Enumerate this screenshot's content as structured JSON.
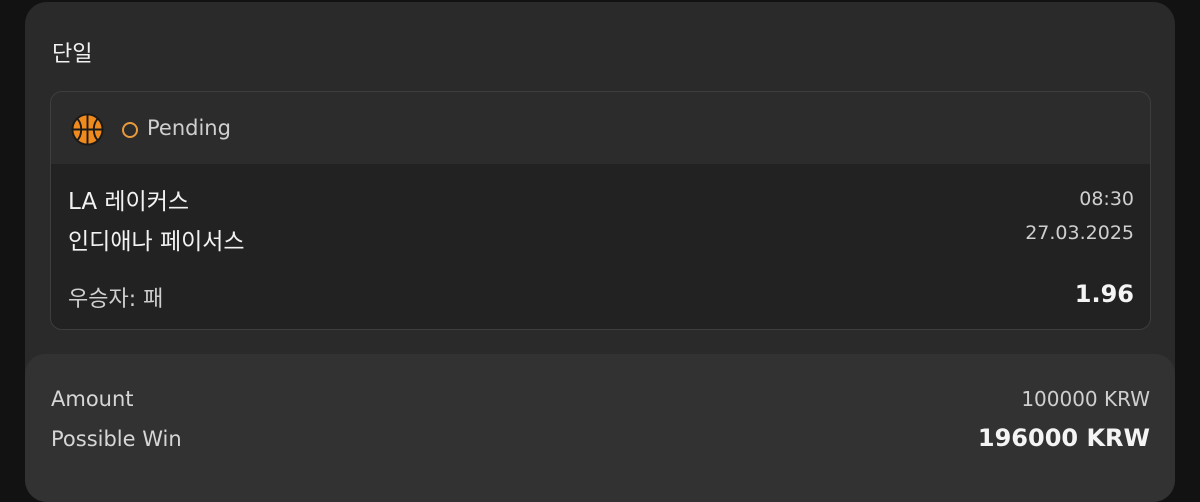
{
  "section_title": "단일",
  "bet": {
    "sport_icon": "basketball-icon",
    "status": "Pending",
    "status_color": "#e89a3c",
    "team_home": "LA 레이커스",
    "team_away": "인디애나 페이서스",
    "time": "08:30",
    "date": "27.03.2025",
    "market": "우승자: 패",
    "odds": "1.96"
  },
  "summary": {
    "amount_label": "Amount",
    "amount_value": "100000 KRW",
    "possible_win_label": "Possible Win",
    "possible_win_value": "196000 KRW"
  }
}
